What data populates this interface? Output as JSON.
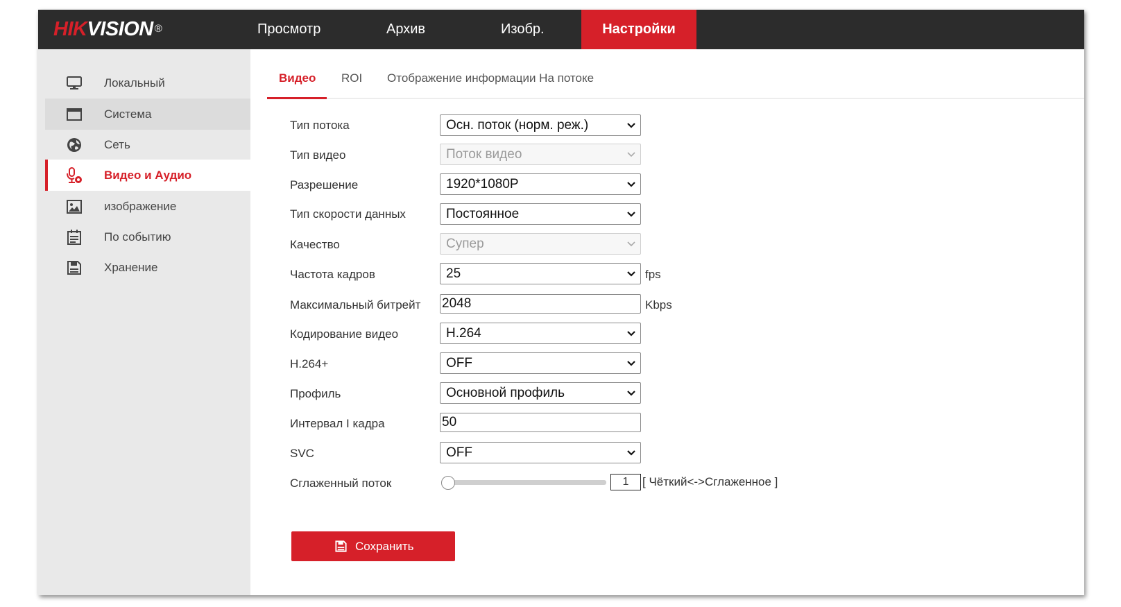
{
  "brand": {
    "logo_part1": "HIK",
    "logo_part2": "VISION",
    "registered": "®"
  },
  "topnav": {
    "items": [
      "Просмотр",
      "Архив",
      "Изобр.",
      "Настройки"
    ],
    "active": "Настройки"
  },
  "sidebar": {
    "items": [
      {
        "label": "Локальный",
        "icon": "monitor-icon"
      },
      {
        "label": "Система",
        "icon": "system-window-icon"
      },
      {
        "label": "Сеть",
        "icon": "globe-icon"
      },
      {
        "label": "Видео и Аудио",
        "icon": "video-audio-icon"
      },
      {
        "label": "изображение",
        "icon": "image-icon"
      },
      {
        "label": "По событию",
        "icon": "calendar-event-icon"
      },
      {
        "label": "Хранение",
        "icon": "floppy-disk-icon"
      }
    ],
    "active": "Видео и Аудио"
  },
  "tabs": {
    "items": [
      "Видео",
      "ROI",
      "Отображение информации На потоке"
    ],
    "active": "Видео"
  },
  "form": {
    "stream_type": {
      "label": "Тип потока",
      "value": "Осн. поток (норм. реж.)"
    },
    "video_type": {
      "label": "Тип видео",
      "value": "Поток видео"
    },
    "resolution": {
      "label": "Разрешение",
      "value": "1920*1080P"
    },
    "bitrate_type": {
      "label": "Тип скорости данных",
      "value": "Постоянное"
    },
    "quality": {
      "label": "Качество",
      "value": "Супер"
    },
    "frame_rate": {
      "label": "Частота кадров",
      "value": "25",
      "unit": "fps"
    },
    "max_bitrate": {
      "label": "Максимальный битрейт",
      "value": "2048",
      "unit": "Kbps"
    },
    "video_encoding": {
      "label": "Кодирование видео",
      "value": "H.264"
    },
    "h264plus": {
      "label": "H.264+",
      "value": "OFF"
    },
    "profile": {
      "label": "Профиль",
      "value": "Основной профиль"
    },
    "i_frame_interval": {
      "label": "Интервал I кадра",
      "value": "50"
    },
    "svc": {
      "label": "SVC",
      "value": "OFF"
    },
    "smoothing": {
      "label": "Сглаженный поток",
      "value": "1",
      "hint": "[ Чёткий<->Сглаженное ]",
      "level_fraction": 0.01
    }
  },
  "save_button": {
    "label": "Сохранить",
    "icon": "floppy-disk-icon"
  },
  "colors": {
    "accent": "#d62029",
    "topbar": "#2c2c2c",
    "sidebar": "#e9e9e9"
  }
}
